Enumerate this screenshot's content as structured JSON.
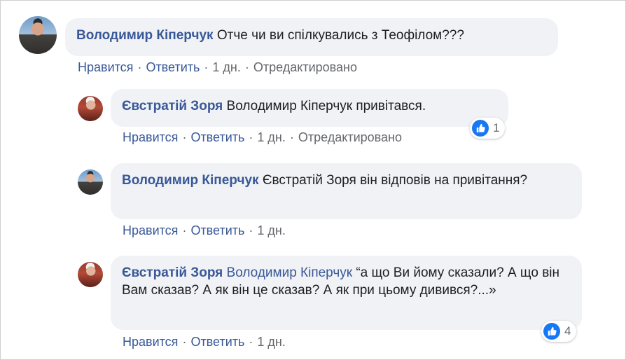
{
  "comments": [
    {
      "author": "Володимир Кіперчук",
      "mention": "",
      "text": "Отче чи ви спілкувались з Теофілом???",
      "actions": {
        "like": "Нравится",
        "reply": "Ответить",
        "time": "1 дн.",
        "edited": "Отредактировано"
      },
      "reactions": null
    },
    {
      "author": "Євстратій Зоря",
      "mention": "",
      "text": "Володимир Кіперчук привітався.",
      "actions": {
        "like": "Нравится",
        "reply": "Ответить",
        "time": "1 дн.",
        "edited": "Отредактировано"
      },
      "reactions": {
        "icon": "like-icon",
        "count": "1"
      }
    },
    {
      "author": "Володимир Кіперчук",
      "mention": "",
      "text": "Євстратій Зоря він відповів на привітання?",
      "actions": {
        "like": "Нравится",
        "reply": "Ответить",
        "time": "1 дн.",
        "edited": ""
      },
      "reactions": null
    },
    {
      "author": "Євстратій Зоря",
      "mention": "Володимир Кіперчук",
      "text": "“а що Ви йому сказали? А що він Вам сказав? А як він це сказав? А як при цьому дивився?...»",
      "actions": {
        "like": "Нравится",
        "reply": "Ответить",
        "time": "1 дн.",
        "edited": ""
      },
      "reactions": {
        "icon": "like-icon",
        "count": "4"
      }
    }
  ],
  "colors": {
    "author": "#385898",
    "meta": "#65676b",
    "bubble": "#f0f2f5",
    "like": "#1877f2"
  }
}
